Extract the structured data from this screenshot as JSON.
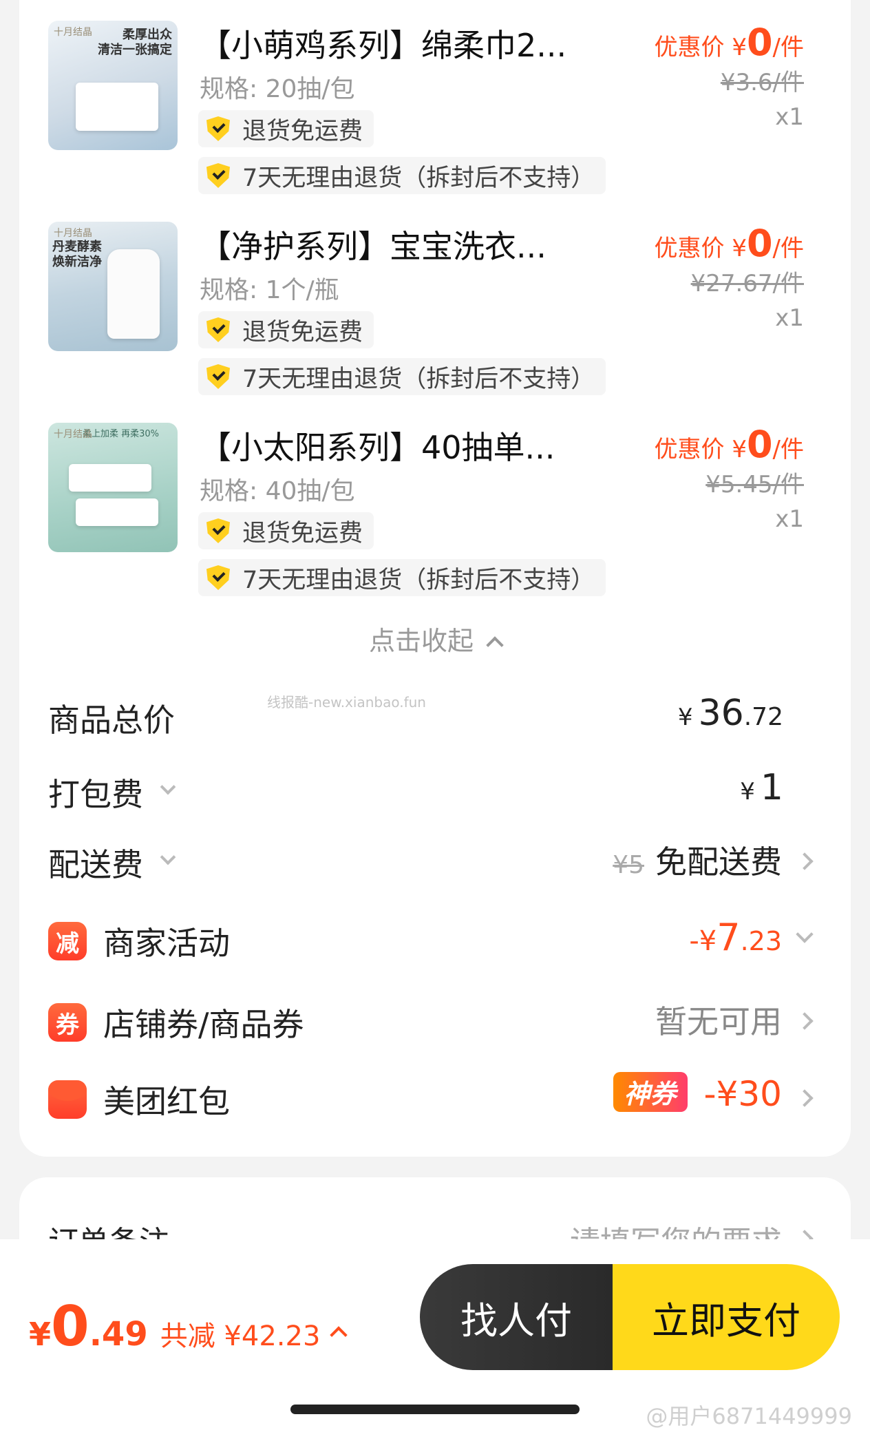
{
  "items": [
    {
      "thumb_brand": "十月结晶",
      "thumb_caption": "柔厚出众\n清洁一张搞定",
      "title": "【小萌鸡系列】绵柔巾2...",
      "spec": "规格: 20抽/包",
      "tags": [
        "退货免运费",
        "7天无理由退货（拆封后不支持）"
      ],
      "promo_label": "优惠价",
      "promo_yen": "¥",
      "promo_price": "0",
      "promo_unit": "/件",
      "orig_price": "¥3.6/件",
      "qty": "x1"
    },
    {
      "thumb_brand": "十月结晶",
      "thumb_caption": "丹麦酵素\n焕新洁净",
      "title": "【净护系列】宝宝洗衣...",
      "spec": "规格: 1个/瓶",
      "tags": [
        "退货免运费",
        "7天无理由退货（拆封后不支持）"
      ],
      "promo_label": "优惠价",
      "promo_yen": "¥",
      "promo_price": "0",
      "promo_unit": "/件",
      "orig_price": "¥27.67/件",
      "qty": "x1"
    },
    {
      "thumb_brand": "十月结晶",
      "thumb_caption": "柔上加柔 再柔30%",
      "title": "【小太阳系列】40抽单...",
      "spec": "规格: 40抽/包",
      "tags": [
        "退货免运费",
        "7天无理由退货（拆封后不支持）"
      ],
      "promo_label": "优惠价",
      "promo_yen": "¥",
      "promo_price": "0",
      "promo_unit": "/件",
      "orig_price": "¥5.45/件",
      "qty": "x1"
    }
  ],
  "collapse_label": "点击收起",
  "watermark_mid": "线报酷-new.xianbao.fun",
  "summary": {
    "goods_total": {
      "label": "商品总价",
      "yen": "¥",
      "int": "36",
      "dec": ".72"
    },
    "packing": {
      "label": "打包费",
      "yen": "¥",
      "int": "1"
    },
    "delivery": {
      "label": "配送费",
      "orig": "¥5",
      "value": "免配送费"
    },
    "merchant": {
      "icon": "减",
      "label": "商家活动",
      "value_prefix": "-¥",
      "int": "7",
      "dec": ".23"
    },
    "coupon": {
      "icon": "券",
      "label": "店铺券/商品券",
      "value": "暂无可用"
    },
    "redpacket": {
      "label": "美团红包",
      "badge": "神券",
      "value": "-¥30"
    }
  },
  "remark": {
    "label": "订单备注",
    "placeholder": "请填写您的要求"
  },
  "bottom": {
    "yen": "¥",
    "int": "0",
    "dec": ".49",
    "saved": "共减 ¥42.23",
    "friend_pay": "找人付",
    "pay_now": "立即支付"
  },
  "watermark": "@用户6871449999",
  "colors": {
    "accent": "#ff4d1c",
    "pay_button": "#ffd91a",
    "friend_button": "#2f2f2f"
  }
}
